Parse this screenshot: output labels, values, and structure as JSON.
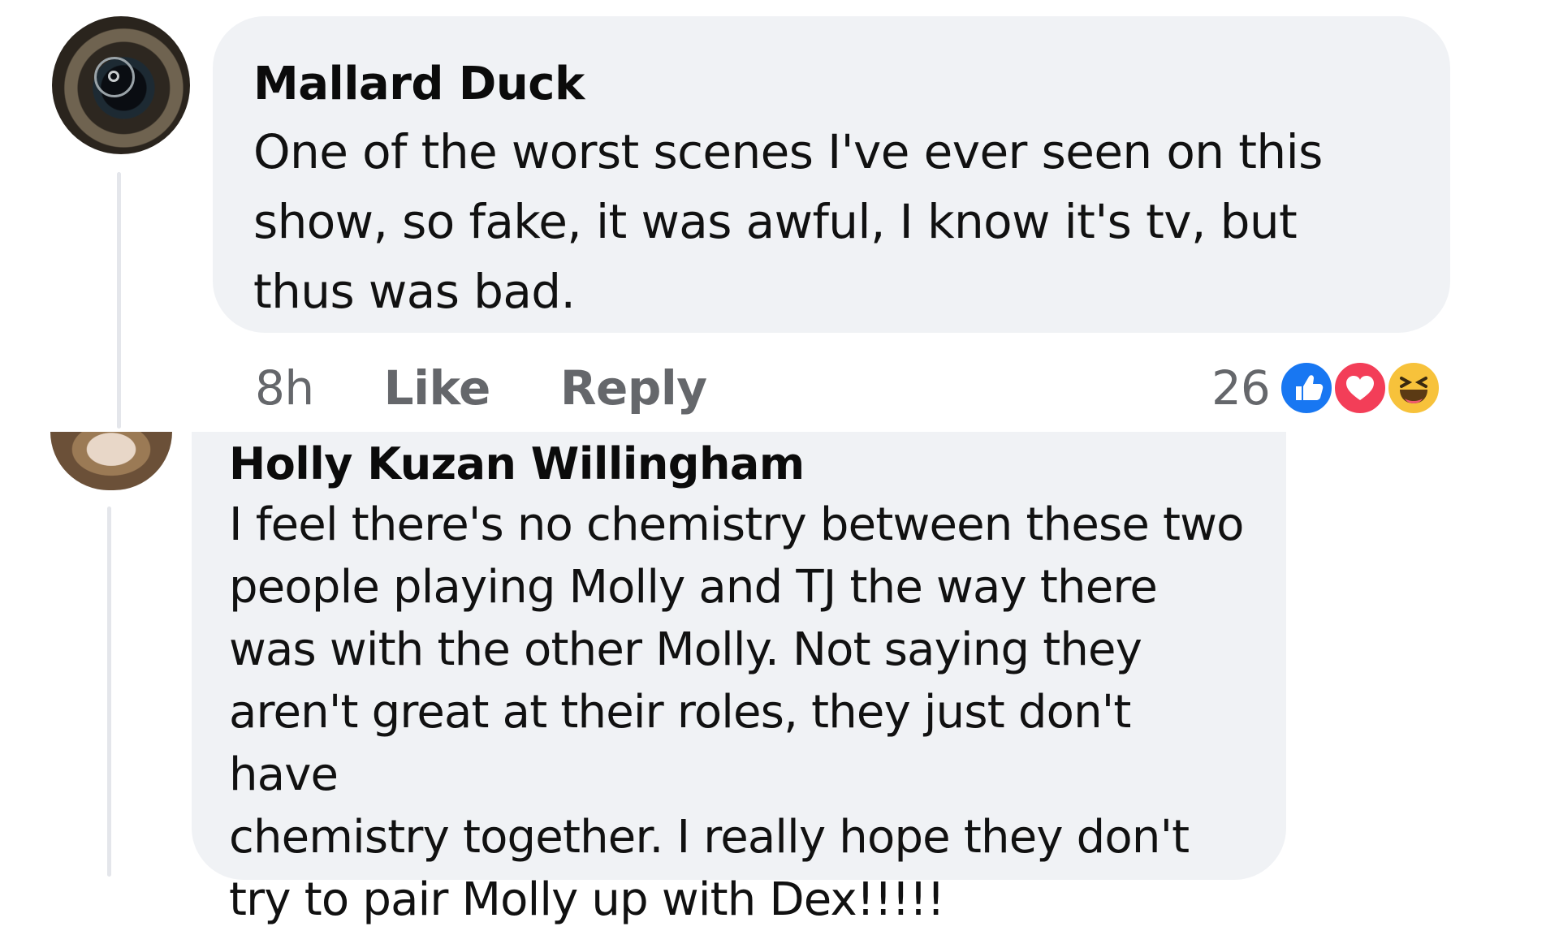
{
  "comments": [
    {
      "author": "Mallard Duck",
      "text": "One of the worst scenes I've ever seen on this show, so fake, it was awful, I know it's tv, but thus was bad.",
      "lines": [
        "One of the worst scenes I've ever seen on this",
        "show, so fake, it was awful, I know it's tv, but",
        "thus was bad."
      ],
      "time": "8h",
      "like_label": "Like",
      "reply_label": "Reply",
      "reaction_count": "26",
      "reactions": [
        "like-icon",
        "love-icon",
        "haha-icon"
      ]
    },
    {
      "author": "Holly Kuzan Willingham",
      "lines": [
        "I feel there's no chemistry between these two",
        "people playing Molly and TJ the way there",
        "was with the other Molly. Not saying they",
        "aren't great at their roles, they just don't have",
        "chemistry together. I really hope they don't",
        "try to pair Molly up with Dex!!!!!"
      ]
    }
  ],
  "colors": {
    "bubble": "#f0f2f5",
    "meta": "#65676b",
    "like": "#1877f2",
    "love": "#f33e58",
    "haha": "#f7c23b"
  }
}
